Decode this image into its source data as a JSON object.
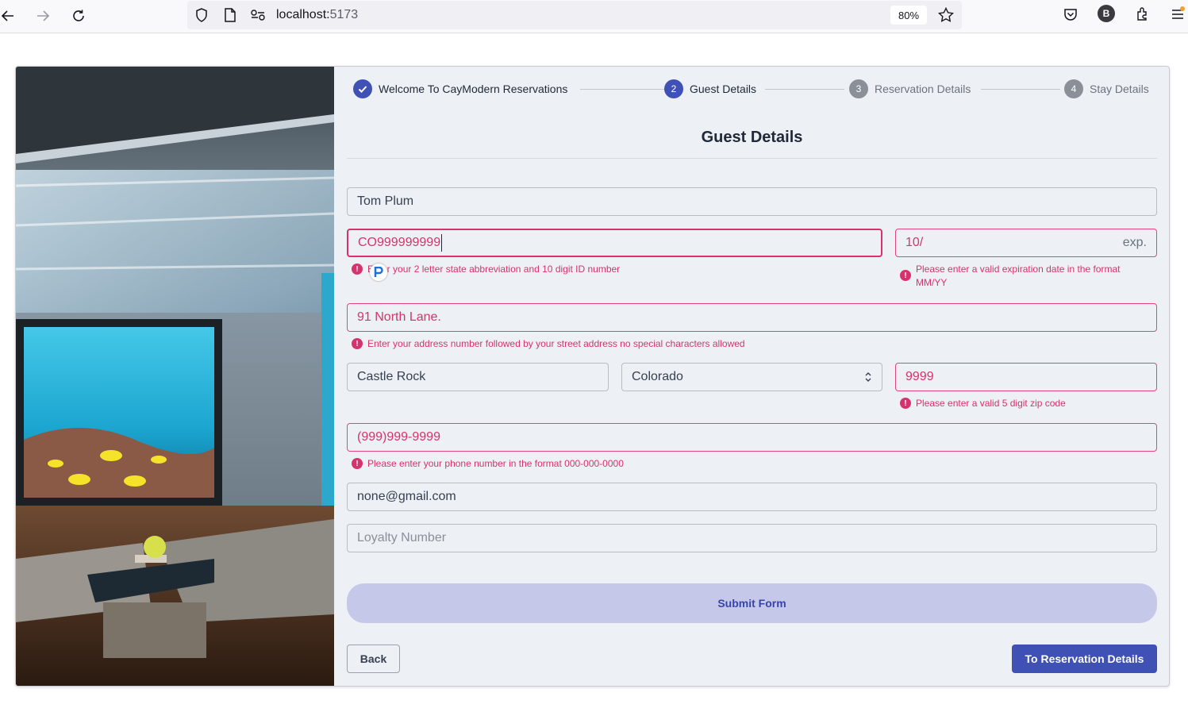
{
  "browser": {
    "url_host": "localhost:",
    "url_port": "5173",
    "zoom": "80%",
    "profile_initial": "B"
  },
  "stepper": {
    "steps": [
      {
        "number": "1",
        "label": "Welcome To CayModern Reservations",
        "state": "complete"
      },
      {
        "number": "2",
        "label": "Guest Details",
        "state": "active"
      },
      {
        "number": "3",
        "label": "Reservation Details",
        "state": "pending"
      },
      {
        "number": "4",
        "label": "Stay Details",
        "state": "pending"
      }
    ]
  },
  "form": {
    "title": "Guest Details",
    "name": "Tom Plum",
    "id_number": "CO999999999",
    "id_error": "Enter your 2 letter state abbreviation and 10 digit ID number",
    "expiration_value": "10/",
    "expiration_suffix": "exp.",
    "expiration_error": "Please enter a valid expiration date in the format MM/YY",
    "address": "91 North Lane.",
    "address_error": "Enter your address number followed by your street address no special characters allowed",
    "city": "Castle Rock",
    "state": "Colorado",
    "zip": "9999",
    "zip_error": "Please enter a valid 5 digit zip code",
    "phone": "(999)999-9999",
    "phone_error": "Please enter your phone number in the format 000-000-0000",
    "email": "none@gmail.com",
    "loyalty_placeholder": "Loyalty Number",
    "submit_label": "Submit Form",
    "back_label": "Back",
    "next_label": "To Reservation Details"
  },
  "colors": {
    "primary": "#3f51b5",
    "error": "#d6336c",
    "submit_bg": "#c5c8e9",
    "form_bg": "#edf0f4"
  }
}
